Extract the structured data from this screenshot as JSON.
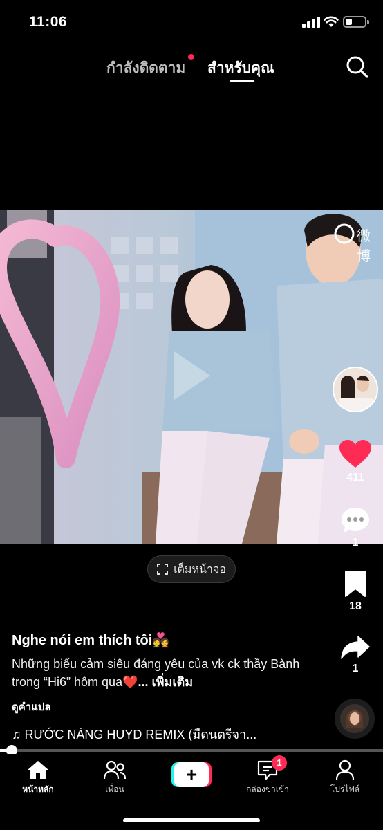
{
  "status_bar": {
    "time": "11:06"
  },
  "top_nav": {
    "tabs": [
      {
        "label": "กำลังติดตาม",
        "active": false,
        "has_dot": true
      },
      {
        "label": "สำหรับคุณ",
        "active": true
      }
    ],
    "search_icon": "search-icon"
  },
  "video": {
    "watermark": "微博",
    "fullscreen_label": "เต็มหน้าจอ"
  },
  "actions": {
    "like_count": "411",
    "comment_count": "1",
    "bookmark_count": "18",
    "share_count": "1"
  },
  "caption": {
    "author": "Nghe nói em thích tôi",
    "author_emoji": "💑",
    "description": "Những biểu cảm siêu đáng yêu của vk ck thầy Bành trong “Hi6” hôm qua",
    "description_emoji": "❤️",
    "more_label": "... เพิ่มเติม",
    "translate_label": "ดูคำแปล",
    "music_note": "♫",
    "music": "RƯỚC NÀNG HUYD REMIX (มืดนตรีจา..."
  },
  "progress": {
    "fraction": 0.03
  },
  "bottom_nav": {
    "items": [
      {
        "label": "หน้าหลัก",
        "icon": "home-icon",
        "active": true
      },
      {
        "label": "เพื่อน",
        "icon": "friends-icon",
        "active": false
      },
      {
        "label": "",
        "icon": "create-icon",
        "active": false
      },
      {
        "label": "กล่องขาเข้า",
        "icon": "inbox-icon",
        "active": false,
        "badge": "1"
      },
      {
        "label": "โปรไฟล์",
        "icon": "profile-icon",
        "active": false
      }
    ]
  },
  "colors": {
    "accent": "#fe2c55",
    "cyan": "#25f4ee",
    "background": "#000000"
  }
}
